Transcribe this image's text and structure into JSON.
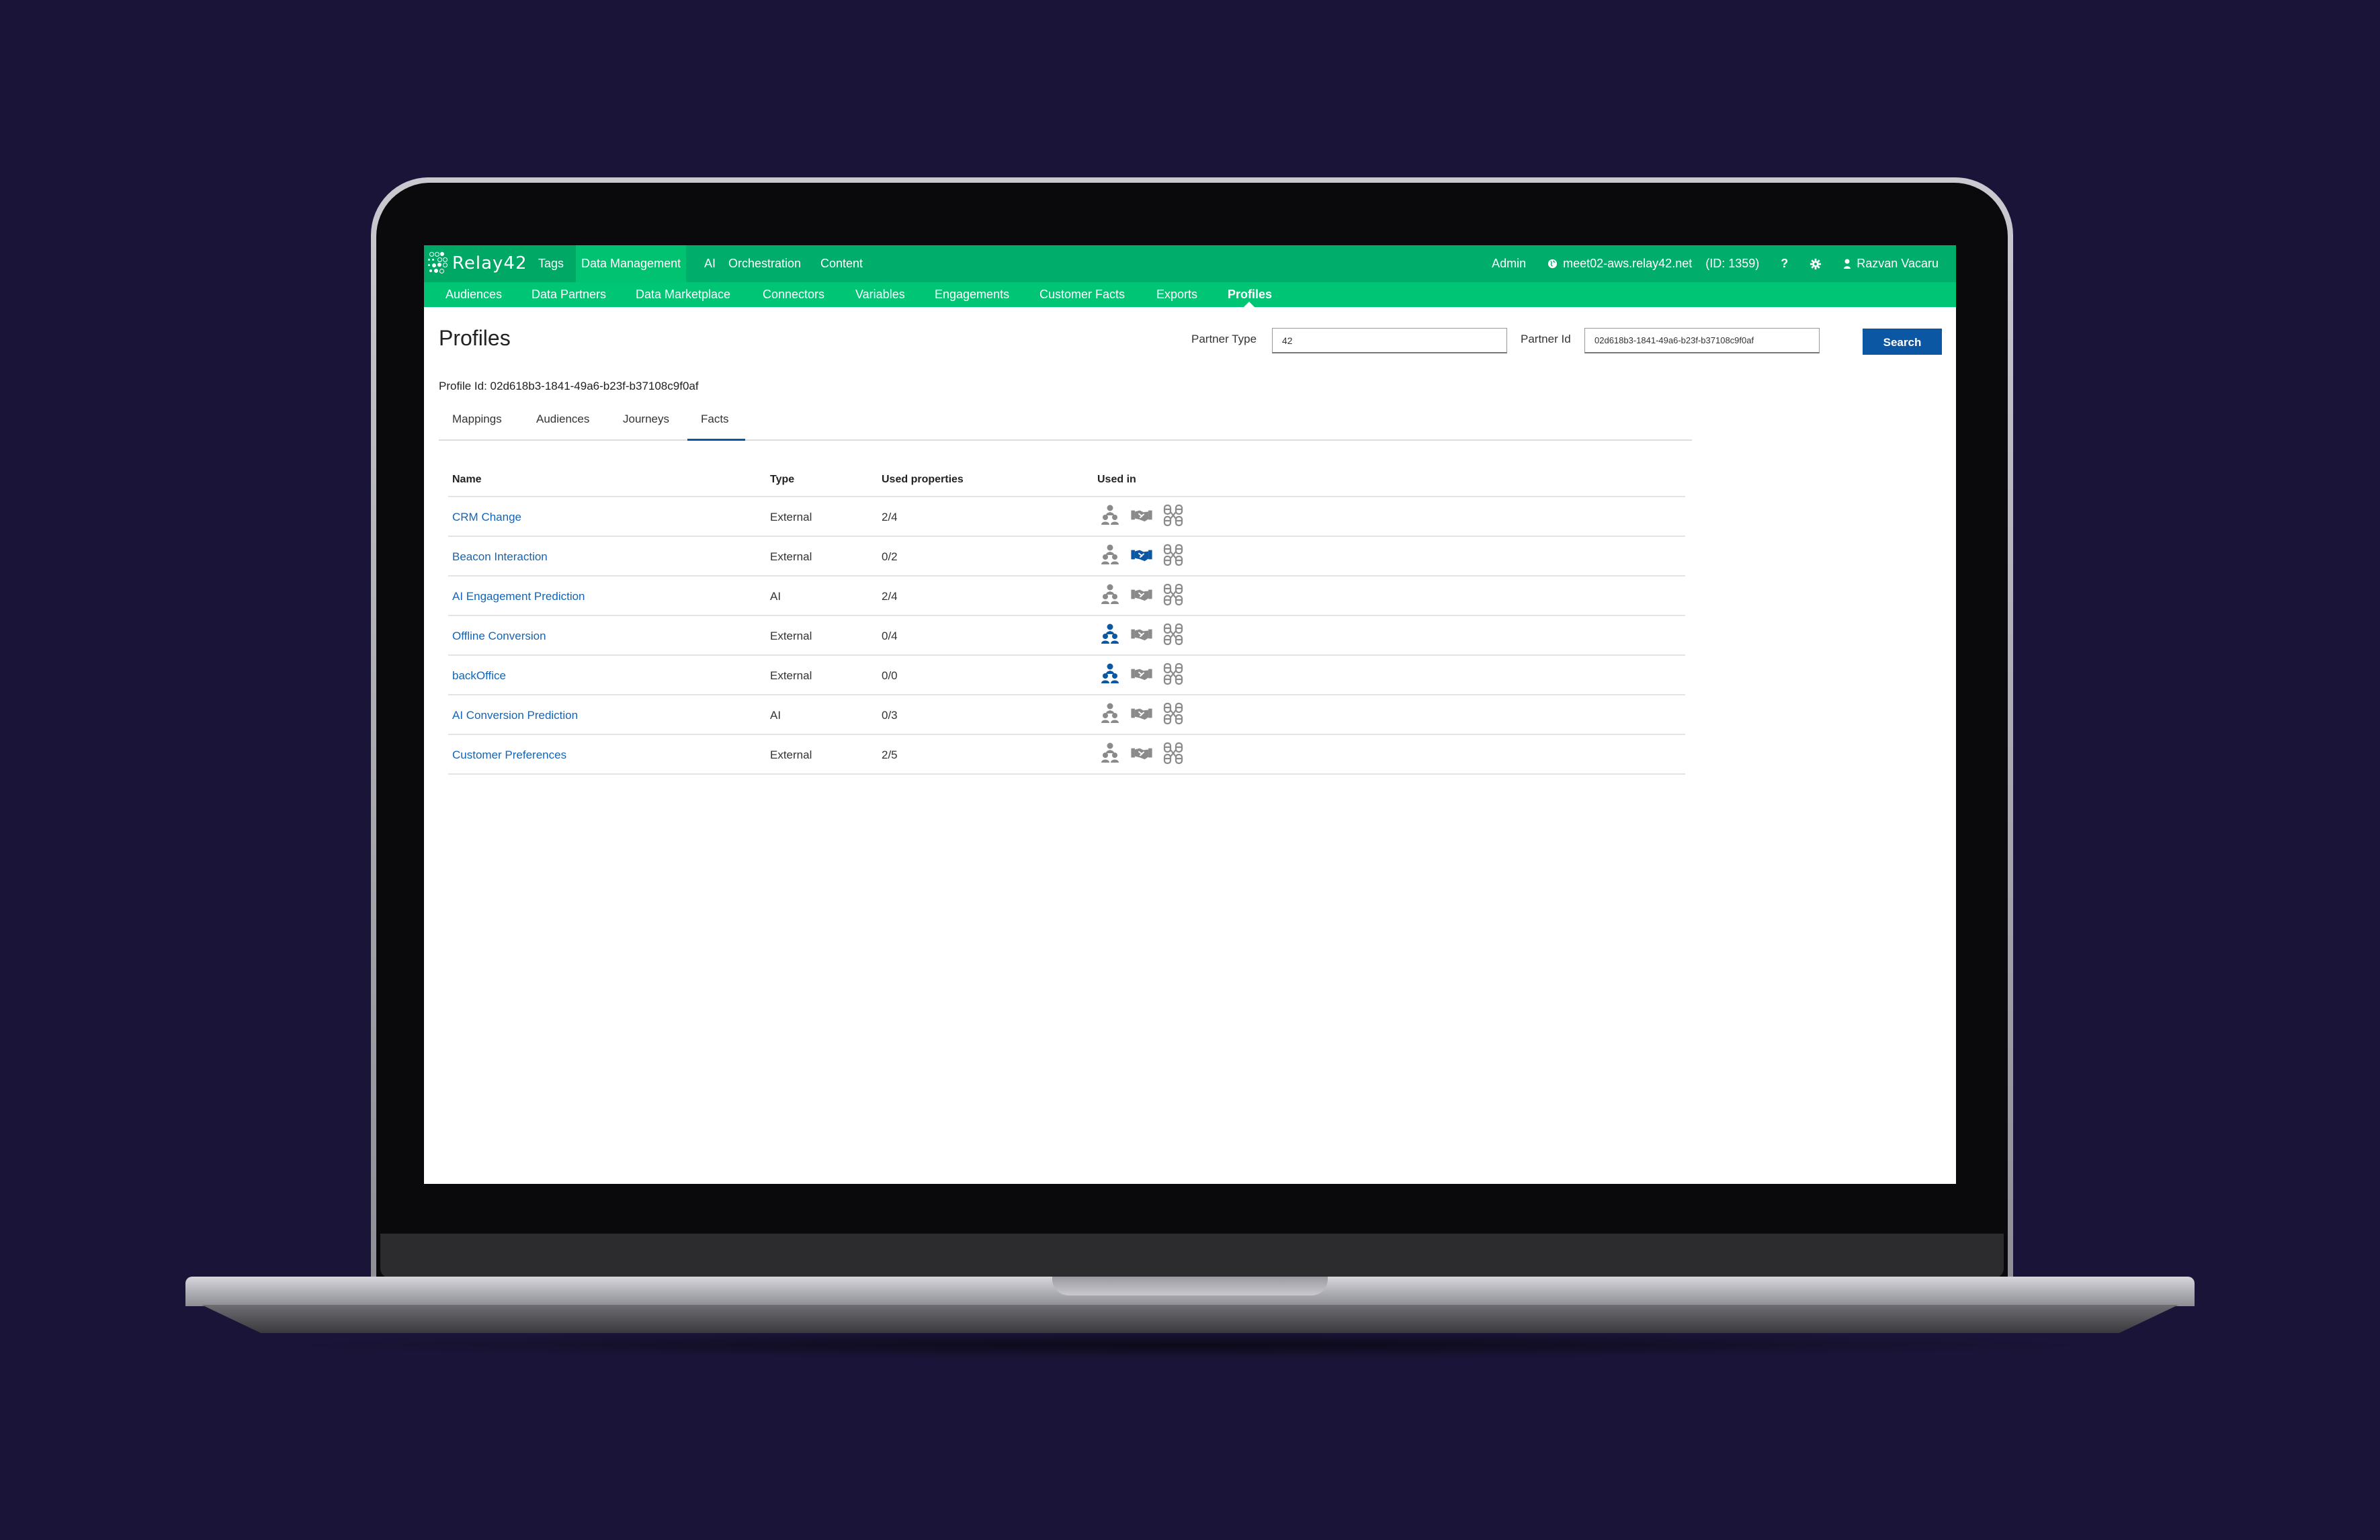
{
  "app": {
    "name": "Relay42"
  },
  "topnav": {
    "items": [
      "Tags",
      "Data Management",
      "AI",
      "Orchestration",
      "Content"
    ],
    "active": "Data Management",
    "right": {
      "role": "Admin",
      "host": "meet02-aws.relay42.net",
      "site_id": "(ID: 1359)",
      "help": "?",
      "user": "Razvan Vacaru"
    }
  },
  "subnav": {
    "items": [
      "Audiences",
      "Data Partners",
      "Data Marketplace",
      "Connectors",
      "Variables",
      "Engagements",
      "Customer Facts",
      "Exports",
      "Profiles"
    ],
    "active": "Profiles"
  },
  "page": {
    "title": "Profiles",
    "partner_type_label": "Partner Type",
    "partner_type_value": "42",
    "partner_id_label": "Partner Id",
    "partner_id_value": "02d618b3-1841-49a6-b23f-b37108c9f0af",
    "search_label": "Search",
    "profile_id": "Profile Id: 02d618b3-1841-49a6-b23f-b37108c9f0af"
  },
  "tabs": [
    "Mappings",
    "Audiences",
    "Journeys",
    "Facts"
  ],
  "active_tab": "Facts",
  "colors": {
    "accent": "#0b57a4",
    "nav_green": "#00ad6b",
    "subnav_green": "#00c574",
    "link": "#1464b4",
    "icon_inactive": "#8a8a8a"
  },
  "table": {
    "headers": [
      "Name",
      "Type",
      "Used properties",
      "Used in"
    ],
    "rows": [
      {
        "name": "CRM Change",
        "type": "External",
        "used": "2/4",
        "used_in": {
          "audiences": false,
          "engagements": false,
          "connectors": false
        }
      },
      {
        "name": "Beacon Interaction",
        "type": "External",
        "used": "0/2",
        "used_in": {
          "audiences": false,
          "engagements": true,
          "connectors": false
        }
      },
      {
        "name": "AI Engagement Prediction",
        "type": "AI",
        "used": "2/4",
        "used_in": {
          "audiences": false,
          "engagements": false,
          "connectors": false
        }
      },
      {
        "name": "Offline Conversion",
        "type": "External",
        "used": "0/4",
        "used_in": {
          "audiences": true,
          "engagements": false,
          "connectors": false
        }
      },
      {
        "name": "backOffice",
        "type": "External",
        "used": "0/0",
        "used_in": {
          "audiences": true,
          "engagements": false,
          "connectors": false
        }
      },
      {
        "name": "AI Conversion Prediction",
        "type": "AI",
        "used": "0/3",
        "used_in": {
          "audiences": false,
          "engagements": false,
          "connectors": false
        }
      },
      {
        "name": "Customer Preferences",
        "type": "External",
        "used": "2/5",
        "used_in": {
          "audiences": false,
          "engagements": false,
          "connectors": false
        }
      }
    ]
  }
}
